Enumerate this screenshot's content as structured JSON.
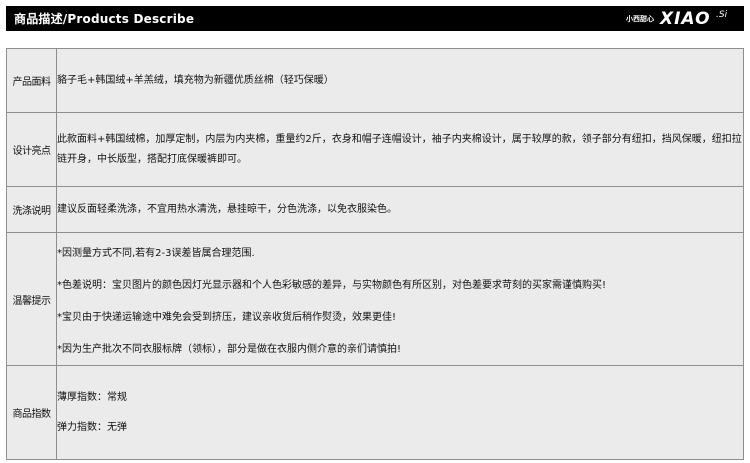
{
  "header": {
    "title": "商品描述/Products Describe",
    "logo_small": "小西甜心",
    "logo_main": "XIAO",
    "logo_suffix": ".Si"
  },
  "rows": [
    {
      "label": "产品面料",
      "lines": [
        "貉子毛+韩国绒+羊羔绒，填充物为新疆优质丝棉（轻巧保暖）"
      ]
    },
    {
      "label": "设计亮点",
      "lines": [
        "此款面料+韩国绒棉，加厚定制，内层为内夹棉，重量约2斤，衣身和帽子连帽设计，袖子内夹棉设计，属于较厚的款，领子部分有纽扣，挡风保暖，纽扣拉链开身，中长版型，搭配打底保暖裤即可。"
      ]
    },
    {
      "label": "洗涤说明",
      "lines": [
        "建议反面轻柔洗涤，不宜用热水清洗，悬挂晾干，分色洗涤，以免衣服染色。"
      ]
    },
    {
      "label": "温馨提示",
      "lines": [
        "*因测量方式不同,若有2-3误差皆属合理范围.",
        "*色差说明：宝贝图片的颜色因灯光显示器和个人色彩敏感的差异，与实物颜色有所区别，对色差要求苛刻的买家需谨慎购买!",
        "*宝贝由于快递运输途中难免会受到挤压，建议亲收货后稍作熨烫，效果更佳!",
        "*因为生产批次不同衣服标牌（领标），部分是做在衣服内侧介意的亲们请慎拍!"
      ]
    },
    {
      "label": "商品指数",
      "lines": [
        "薄厚指数：常规",
        "弹力指数：无弹"
      ]
    }
  ]
}
